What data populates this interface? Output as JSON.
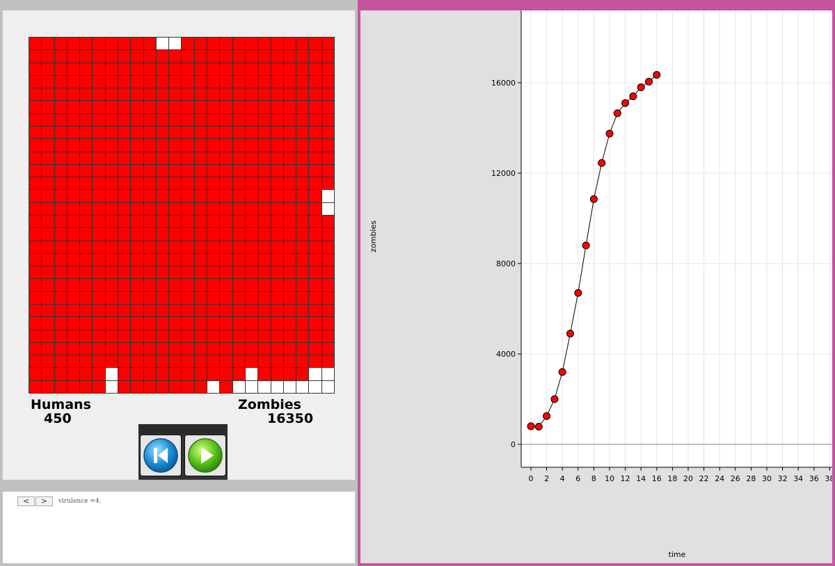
{
  "simulation": {
    "grid_cols": 24,
    "grid_rows": 28,
    "zombie_color": "#ff0000",
    "human_color": "#ffffff",
    "human_cells": [
      [
        0,
        10
      ],
      [
        0,
        11
      ],
      [
        12,
        23
      ],
      [
        13,
        23
      ],
      [
        26,
        6
      ],
      [
        27,
        6
      ],
      [
        27,
        14
      ],
      [
        26,
        17
      ],
      [
        27,
        16
      ],
      [
        27,
        17
      ],
      [
        27,
        18
      ],
      [
        27,
        19
      ],
      [
        27,
        20
      ],
      [
        27,
        21
      ],
      [
        27,
        22
      ],
      [
        27,
        23
      ],
      [
        26,
        22
      ],
      [
        26,
        23
      ]
    ],
    "humans_label": "Humans",
    "humans_count": "450",
    "zombies_label": "Zombies",
    "zombies_count": "16350"
  },
  "controls": {
    "rewind_icon": "skip-back-icon",
    "play_icon": "play-icon"
  },
  "status": {
    "prev_label": "<",
    "next_label": ">",
    "virulence_text": "virulence  =4."
  },
  "chart_data": {
    "type": "line",
    "xlabel": "time",
    "ylabel": "zombies",
    "x_ticks": [
      0,
      2,
      4,
      6,
      8,
      10,
      12,
      14,
      16,
      18,
      20,
      22,
      24,
      26,
      28,
      30,
      32,
      34,
      36,
      38
    ],
    "y_ticks": [
      0,
      4000,
      8000,
      12000,
      16000
    ],
    "series": [
      {
        "x": [
          0,
          1,
          2,
          3,
          4,
          5,
          6,
          7,
          8,
          9,
          10,
          11,
          12,
          13,
          14,
          15,
          16
        ],
        "values": [
          800,
          780,
          1250,
          2000,
          3200,
          4900,
          6700,
          8800,
          10850,
          12450,
          13750,
          14650,
          15100,
          15400,
          15800,
          16050,
          16350
        ],
        "marker_color": "#ff0000"
      }
    ],
    "grid": true
  }
}
